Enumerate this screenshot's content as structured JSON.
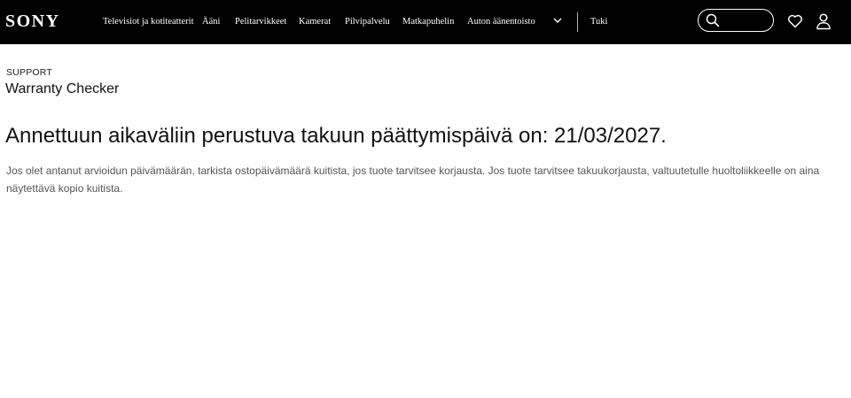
{
  "header": {
    "logo": "SONY",
    "nav_items": [
      "Televisiot ja kotiteatterit",
      "Ääni",
      "Pelitarvikkeet",
      "Kamerat",
      "Pilvipalvelu",
      "Matkapuhelin",
      "Auton äänentoisto"
    ],
    "more_icon": "chevron-down-icon",
    "support_link": "Tuki",
    "search": {
      "value": "",
      "placeholder": "",
      "icon": "search-icon"
    },
    "wishlist_icon": "heart-icon",
    "account_icon": "user-icon",
    "background": "#000000",
    "text_color": "#ffffff"
  },
  "main": {
    "eyebrow": "SUPPORT",
    "title": "Warranty Checker",
    "result_heading": "Annettuun aikaväliin perustuva takuun päättymispäivä on: 21/03/2027.",
    "description": "Jos olet antanut arvioidun päivämäärän, tarkista ostopäivämäärä kuitista, jos tuote tarvitsee korjausta. Jos tuote tarvitsee takuukorjausta, valtuutetulle huoltoliikkeelle on aina näytettävä kopio kuitista."
  }
}
